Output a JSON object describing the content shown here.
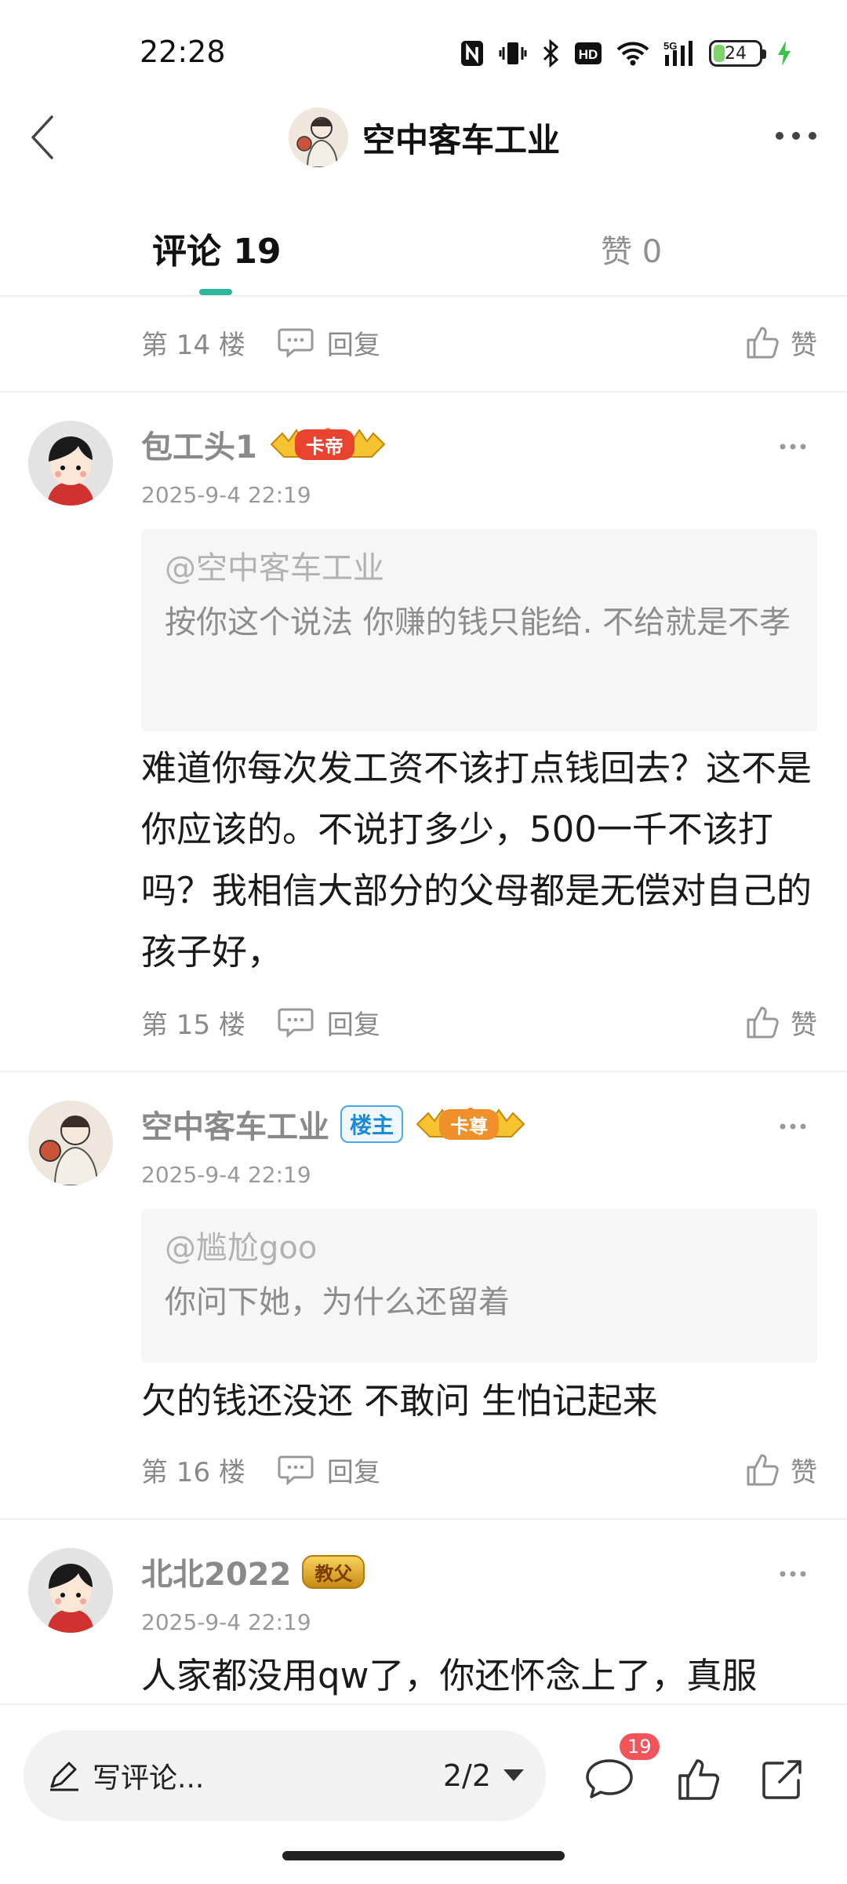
{
  "status_bar": {
    "time": "22:28",
    "battery": "24",
    "icons": [
      "nfc-icon",
      "vibrate-icon",
      "bluetooth-icon",
      "hd-icon",
      "wifi-icon",
      "signal-5g-icon",
      "battery-icon",
      "charging-icon"
    ],
    "hd_label": "HD",
    "net_label": "5G"
  },
  "header": {
    "title": "空中客车工业"
  },
  "tabs": {
    "comments_label": "评论 19",
    "likes_label": "赞 0",
    "accent_color": "#2ab79b"
  },
  "comments": [
    {
      "floor": "第 14 楼",
      "reply_label": "回复",
      "like_label": "赞"
    },
    {
      "user": "包工头1",
      "rank": "卡帝",
      "time": "2025-9-4 22:19",
      "quote_user": "@空中客车工业",
      "quote_text": "按你这个说法 你赚的钱只能给. 不给就是不孝",
      "content": "难道你每次发工资不该打点钱回去？这不是你应该的。不说打多少，500一千不该打吗？我相信大部分的父母都是无偿对自己的孩子好，",
      "floor": "第 15 楼",
      "reply_label": "回复",
      "like_label": "赞"
    },
    {
      "user": "空中客车工业",
      "op_badge": "楼主",
      "rank": "卡尊",
      "time": "2025-9-4 22:19",
      "quote_user": "@尴尬goo",
      "quote_text": "你问下她，为什么还留着",
      "content": "欠的钱还没还 不敢问 生怕记起来",
      "floor": "第 16 楼",
      "reply_label": "回复",
      "like_label": "赞"
    },
    {
      "user": "北北2022",
      "rank": "教父",
      "time": "2025-9-4 22:19",
      "content": "人家都没用qw了，你还怀念上了，真服"
    }
  ],
  "bottom_bar": {
    "input_placeholder": "写评论...",
    "page_indicator": "2/2",
    "comment_count": "19",
    "badge_color": "#f2545b"
  }
}
